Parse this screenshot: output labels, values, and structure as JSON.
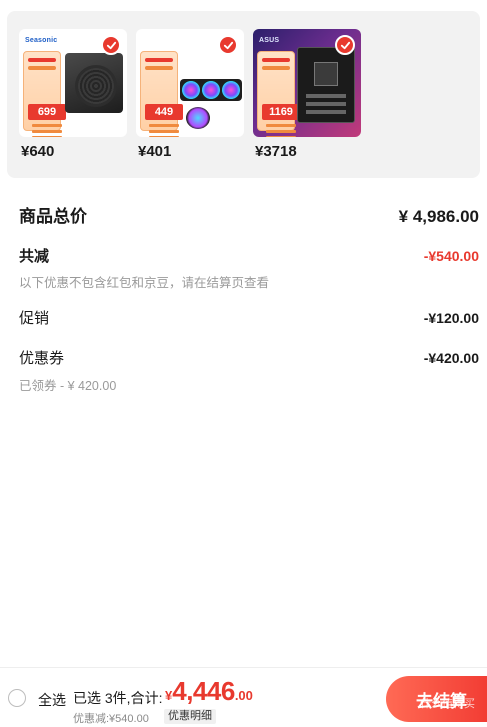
{
  "products": [
    {
      "price": "¥640",
      "brand": "Seasonic",
      "promo_price": "699"
    },
    {
      "price": "¥401",
      "promo_price": "449"
    },
    {
      "price": "¥3718",
      "brand": "ASUS",
      "promo_price": "1169"
    }
  ],
  "summary": {
    "goods_total_label": "商品总价",
    "goods_total_value": "¥ 4,986.00",
    "discount_label": "共减",
    "discount_value": "-¥540.00",
    "discount_note": "以下优惠不包含红包和京豆，请在结算页查看",
    "promotion_label": "促销",
    "promotion_value": "-¥120.00",
    "coupon_label": "优惠券",
    "coupon_value": "-¥420.00",
    "coupon_note": "已领券 - ¥ 420.00"
  },
  "bottom_bar": {
    "select_all_label": "全选",
    "selected_count": "已选 3件,合计:",
    "total_currency": "¥",
    "total_integer": "4,446",
    "total_decimal": ".00",
    "discount_text": "优惠减:¥540.00",
    "detail_label": "优惠明细",
    "checkout_label": "去结算",
    "watermark": "什么值得买"
  },
  "colors": {
    "accent": "#e8392e",
    "panel_bg": "#f2f2f2"
  }
}
